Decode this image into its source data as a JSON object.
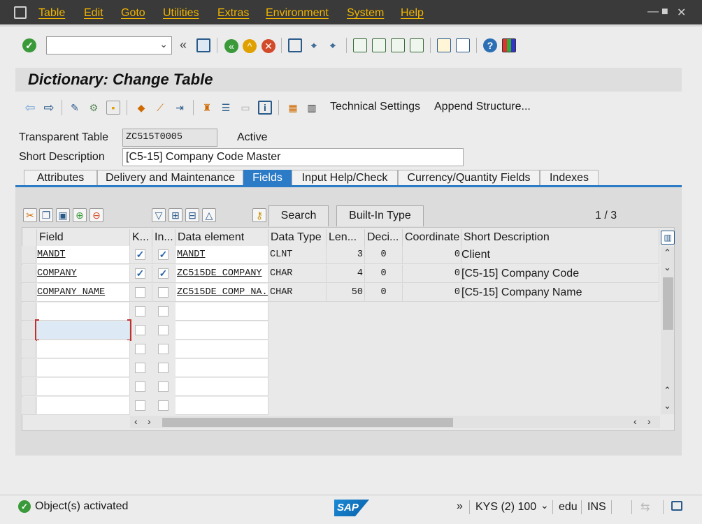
{
  "menu": [
    "Table",
    "Edit",
    "Goto",
    "Utilities",
    "Extras",
    "Environment",
    "System",
    "Help"
  ],
  "window_controls": {
    "minimize": "—",
    "maximize": "■",
    "close": "✕"
  },
  "toolbar": {
    "command_field_value": "",
    "icons": [
      "enter-icon",
      "dropdown-icon",
      "double-left-icon",
      "save-icon",
      "back-icon",
      "exit-icon",
      "cancel-icon",
      "print-icon",
      "find-icon",
      "find-next-icon",
      "first-page-icon",
      "previous-page-icon",
      "next-page-icon",
      "last-page-icon",
      "new-session-icon",
      "shortcut-icon",
      "help-icon",
      "customize-layout-icon"
    ],
    "collapse_glyph": "«"
  },
  "title": "Dictionary: Change Table",
  "app_toolbar": {
    "technical_settings": "Technical Settings",
    "append_structure": "Append Structure..."
  },
  "header": {
    "transparent_table_label": "Transparent Table",
    "transparent_table_value": "ZC515T0005",
    "status": "Active",
    "short_description_label": "Short Description",
    "short_description_value": "[C5-15] Company Code Master"
  },
  "tabs": [
    "Attributes",
    "Delivery and Maintenance",
    "Fields",
    "Input Help/Check",
    "Currency/Quantity Fields",
    "Indexes"
  ],
  "active_tab": "Fields",
  "grid_toolbar": {
    "search": "Search",
    "builtin_type": "Built-In Type",
    "page_indicator": "1 / 3"
  },
  "columns": [
    "Field",
    "K...",
    "In...",
    "Data element",
    "Data Type",
    "Len...",
    "Deci...",
    "Coordinate",
    "Short Description"
  ],
  "rows": [
    {
      "field": "MANDT",
      "key": true,
      "initial": true,
      "data_element": "MANDT",
      "data_type": "CLNT",
      "length": "3",
      "decimals": "0",
      "coordinate": "0",
      "short_description": "Client"
    },
    {
      "field": "COMPANY",
      "key": true,
      "initial": true,
      "data_element": "ZC515DE_COMPANY",
      "data_type": "CHAR",
      "length": "4",
      "decimals": "0",
      "coordinate": "0",
      "short_description": "[C5-15] Company Code"
    },
    {
      "field": "COMPANY_NAME",
      "key": false,
      "initial": false,
      "data_element": "ZC515DE_COMP_NA...",
      "data_type": "CHAR",
      "length": "50",
      "decimals": "0",
      "coordinate": "0",
      "short_description": "[C5-15] Company Name"
    }
  ],
  "status_bar": {
    "message": "Object(s) activated",
    "logo": "SAP",
    "system": "KYS (2) 100",
    "client_user": "edu",
    "mode": "INS"
  },
  "colors": {
    "accent": "#2c7bc7",
    "menu_text": "#f0b400",
    "success": "#3a9a3a"
  }
}
